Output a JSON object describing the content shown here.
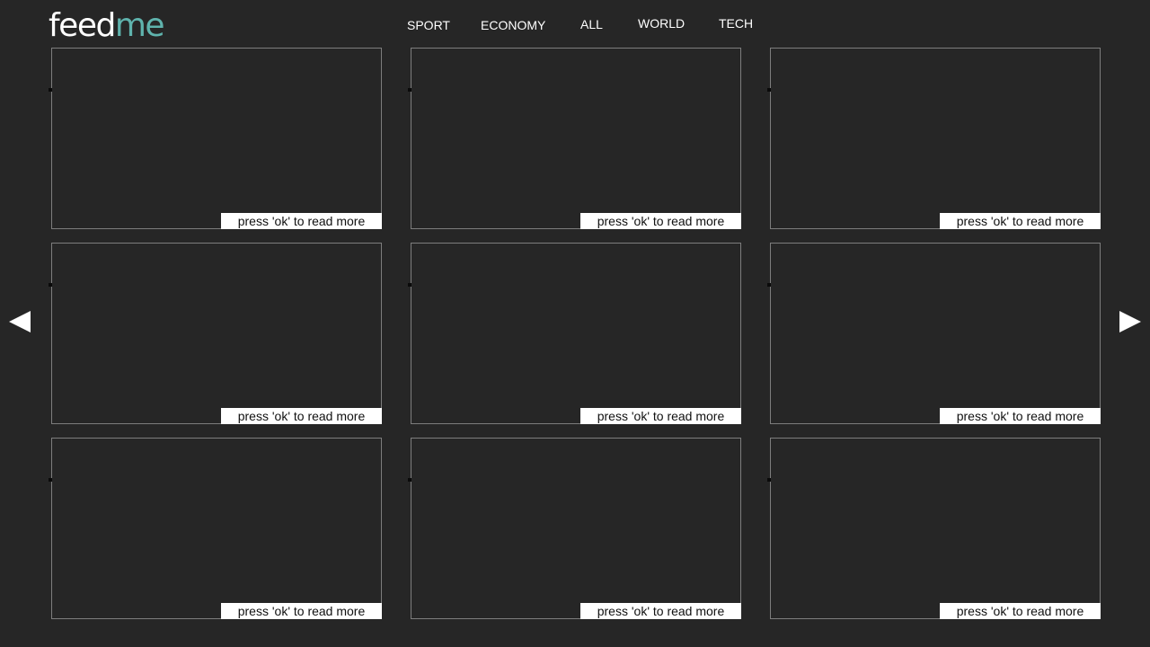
{
  "header": {
    "logo_part1": "feed",
    "logo_part2": "me",
    "logo_accent_color": "#5fb3ad"
  },
  "nav": {
    "items": [
      {
        "label": "SPORT"
      },
      {
        "label": "ECONOMY"
      },
      {
        "label": "ALL"
      },
      {
        "label": "WORLD"
      },
      {
        "label": "TECH"
      }
    ]
  },
  "grid": {
    "tiles": [
      {
        "cta": "press 'ok' to read more"
      },
      {
        "cta": "press 'ok' to read more"
      },
      {
        "cta": "press 'ok' to read more"
      },
      {
        "cta": "press 'ok' to read more"
      },
      {
        "cta": "press 'ok' to read more"
      },
      {
        "cta": "press 'ok' to read more"
      },
      {
        "cta": "press 'ok' to read more"
      },
      {
        "cta": "press 'ok' to read more"
      },
      {
        "cta": "press 'ok' to read more"
      }
    ]
  },
  "pagination": {
    "prev_icon": "triangle-left-icon",
    "next_icon": "triangle-right-icon"
  },
  "colors": {
    "background": "#262626",
    "tile_border": "#7d7d7d",
    "cta_background": "#ffffff"
  }
}
